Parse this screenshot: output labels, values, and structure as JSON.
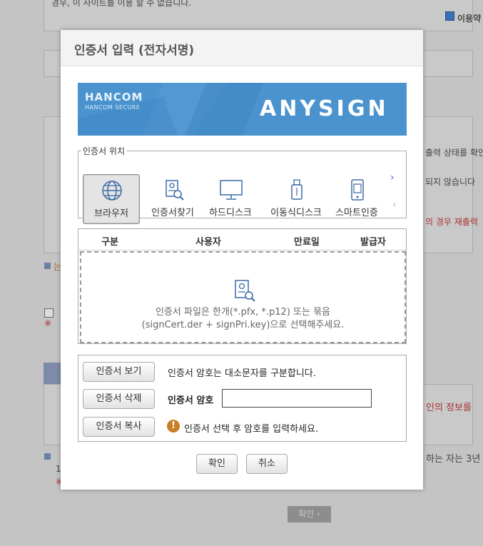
{
  "background": {
    "line_top": "경우, 이 사이트를 이용 할 수 없습니다.",
    "agree_label": "이용약",
    "right_line_1": "출력 상태를 확인",
    "right_line_2": "되지 않습니다",
    "right_line_3": "의 경우 재출력",
    "right_line_4": "인의 정보를",
    "right_line_5": "하는 자는 3년",
    "left_fragment_1": "는",
    "left_fragment_2": "※",
    "left_fragment_3": "※",
    "left_fragment_4": "1",
    "confirm_label": "확인 ›"
  },
  "dialog": {
    "title": "인증서 입력 (전자서명)",
    "brand_logo": "HANCOM",
    "brand_sub": "HANCOM SECURE",
    "product_logo": "ANYSIGN",
    "location_legend": "인증서 위치",
    "locations": [
      {
        "label": "브라우저",
        "icon": "globe-icon",
        "selected": true
      },
      {
        "label": "인증서찾기",
        "icon": "cert-search-icon",
        "selected": false
      },
      {
        "label": "하드디스크",
        "icon": "monitor-icon",
        "selected": false
      },
      {
        "label": "이동식디스크",
        "icon": "usb-icon",
        "selected": false
      },
      {
        "label": "스마트인증",
        "icon": "smartphone-icon",
        "selected": false
      }
    ],
    "arrow_next": "›",
    "arrow_prev": "‹",
    "table_headers": [
      "구분",
      "사용자",
      "만료일",
      "발급자"
    ],
    "drop_text_line1": "인증서 파일은 한개(*.pfx, *.p12) 또는 묶음",
    "drop_text_line2": "(signCert.der + signPri.key)으로 선택해주세요.",
    "view_button": "인증서 보기",
    "delete_button": "인증서 삭제",
    "copy_button": "인증서 복사",
    "case_hint": "인증서 암호는 대소문자를 구분합니다.",
    "password_label": "인증서 암호",
    "password_value": "",
    "warning_symbol": "!",
    "warning_text": "인증서 선택 후 암호를 입력하세요.",
    "ok_button": "확인",
    "cancel_button": "취소"
  },
  "colors": {
    "banner": "#4a93cf",
    "warning": "#c97d24",
    "selected_bg": "#e4e4e4"
  }
}
